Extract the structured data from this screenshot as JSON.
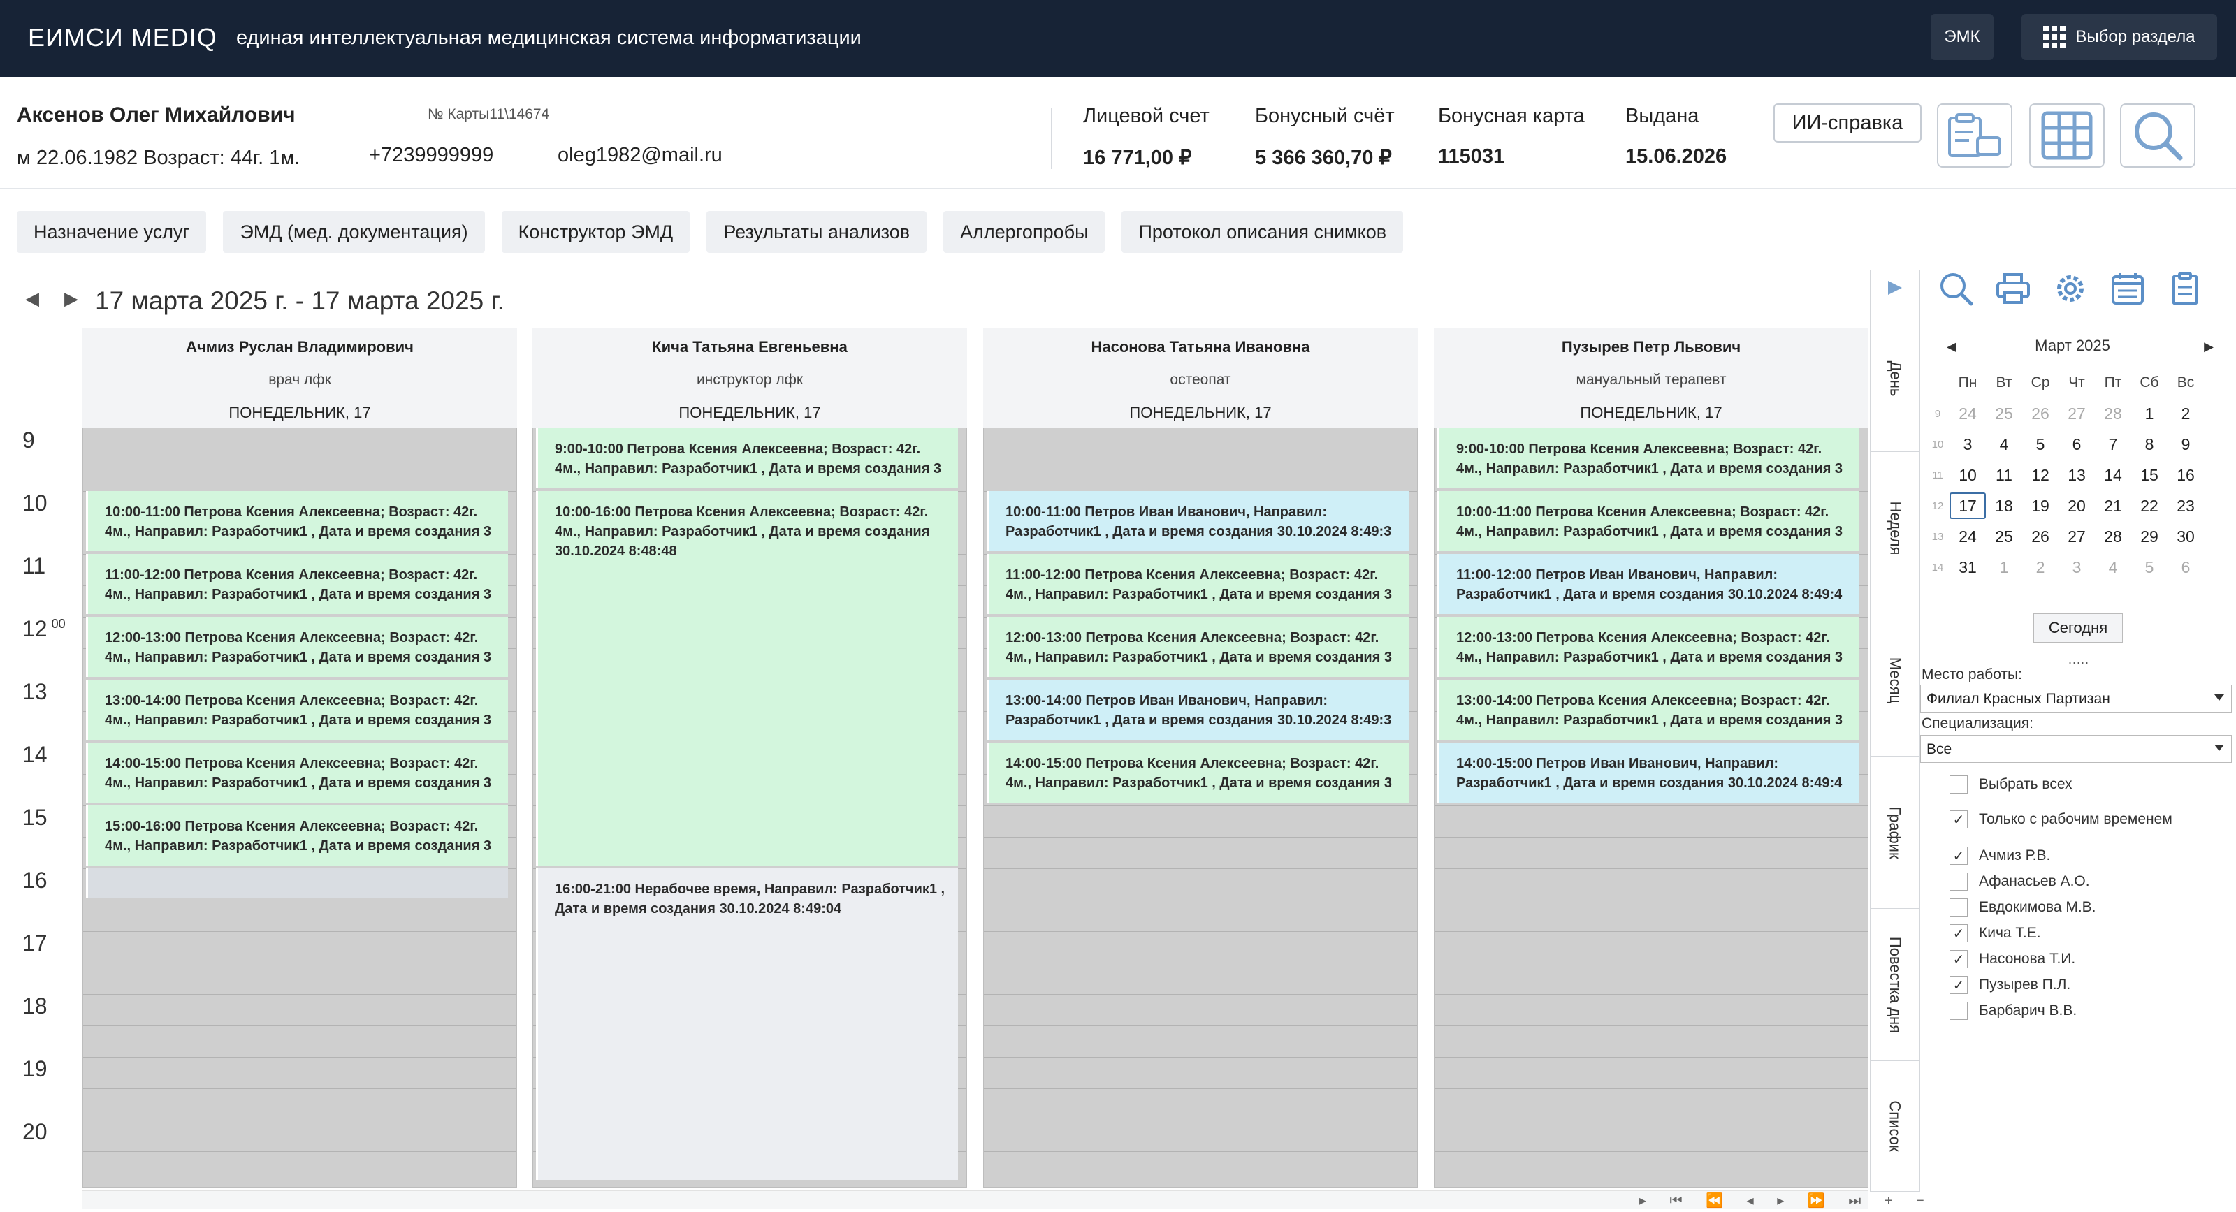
{
  "topbar": {
    "logo": "ЕИМСИ MEDIQ",
    "subtitle": "единая интеллектуальная медицинская система информатизации",
    "emk_button": "ЭМК",
    "section_button": "Выбор раздела"
  },
  "patient": {
    "name": "Аксенов Олег Михайлович",
    "card": "№ Карты11\\14674",
    "gender_dob_age": "м 22.06.1982 Возраст: 44г. 1м.",
    "phone": "+7239999999",
    "email": "oleg1982@mail.ru",
    "account_label": "Лицевой счет",
    "account_value": "16 771,00 ₽",
    "bonus_label": "Бонусный счёт",
    "bonus_value": "5 366 360,70 ₽",
    "card_label": "Бонусная карта",
    "card_value": "115031",
    "issued_label": "Выдана",
    "issued_value": "15.06.2026",
    "ai_button": "ИИ-справка"
  },
  "tabs": [
    "Назначение услуг",
    "ЭМД (мед. документация)",
    "Конструктор ЭМД",
    "Результаты анализов",
    "Аллергопробы",
    "Протокол описания снимков"
  ],
  "date_range": "17 марта 2025 г. - 17 марта 2025 г.",
  "hours": [
    "9",
    "10",
    "11",
    "12",
    "13",
    "14",
    "15",
    "16",
    "17",
    "18",
    "19",
    "20"
  ],
  "hour_minutes_label": "00",
  "doctors": [
    {
      "name": "Ачмиз Руслан Владимирович",
      "role": "врач лфк",
      "day": "ПОНЕДЕЛЬНИК, 17",
      "appointments": [
        {
          "text": "10:00-11:00 Петрова Ксения Алексеевна; Возраст: 42г. 4м., Направил: Разработчик1 , Дата и время создания 3",
          "color": "green"
        },
        {
          "text": "11:00-12:00 Петрова Ксения Алексеевна; Возраст: 42г. 4м., Направил: Разработчик1 , Дата и время создания 3",
          "color": "green"
        },
        {
          "text": "12:00-13:00 Петрова Ксения Алексеевна; Возраст: 42г. 4м., Направил: Разработчик1 , Дата и время создания 3",
          "color": "green"
        },
        {
          "text": "13:00-14:00 Петрова Ксения Алексеевна; Возраст: 42г. 4м., Направил: Разработчик1 , Дата и время создания 3",
          "color": "green"
        },
        {
          "text": "14:00-15:00 Петрова Ксения Алексеевна; Возраст: 42г. 4м., Направил: Разработчик1 , Дата и время создания 3",
          "color": "green"
        },
        {
          "text": "15:00-16:00 Петрова Ксения Алексеевна; Возраст: 42г. 4м., Направил: Разработчик1 , Дата и время создания 3",
          "color": "green"
        }
      ]
    },
    {
      "name": "Кича Татьяна Евгеньевна",
      "role": "инструктор лфк",
      "day": "ПОНЕДЕЛЬНИК, 17",
      "appointments": [
        {
          "text": "9:00-10:00 Петрова Ксения Алексеевна; Возраст: 42г. 4м., Направил: Разработчик1 , Дата и время создания 3",
          "color": "green"
        },
        {
          "text": "10:00-16:00 Петрова Ксения Алексеевна; Возраст: 42г. 4м., Направил: Разработчик1 , Дата и время создания 30.10.2024 8:48:48",
          "color": "green"
        },
        {
          "text": "16:00-21:00 Нерабочее время, Направил: Разработчик1 , Дата и время создания 30.10.2024 8:49:04",
          "color": "grey"
        }
      ]
    },
    {
      "name": "Насонова Татьяна Ивановна",
      "role": "остеопат",
      "day": "ПОНЕДЕЛЬНИК, 17",
      "appointments": [
        {
          "text": "10:00-11:00 Петров Иван Иванович, Направил: Разработчик1 , Дата и время создания 30.10.2024 8:49:3",
          "color": "blue"
        },
        {
          "text": "11:00-12:00 Петрова Ксения Алексеевна; Возраст: 42г. 4м., Направил: Разработчик1 , Дата и время создания 3",
          "color": "green"
        },
        {
          "text": "12:00-13:00 Петрова Ксения Алексеевна; Возраст: 42г. 4м., Направил: Разработчик1 , Дата и время создания 3",
          "color": "green"
        },
        {
          "text": "13:00-14:00 Петров Иван Иванович, Направил: Разработчик1 , Дата и время создания 30.10.2024 8:49:3",
          "color": "blue"
        },
        {
          "text": "14:00-15:00 Петрова Ксения Алексеевна; Возраст: 42г. 4м., Направил: Разработчик1 , Дата и время создания 3",
          "color": "green"
        }
      ]
    },
    {
      "name": "Пузырев Петр Львович",
      "role": "мануальный терапевт",
      "day": "ПОНЕДЕЛЬНИК, 17",
      "appointments": [
        {
          "text": "9:00-10:00 Петрова Ксения Алексеевна; Возраст: 42г. 4м., Направил: Разработчик1 , Дата и время создания 3",
          "color": "green"
        },
        {
          "text": "10:00-11:00 Петрова Ксения Алексеевна; Возраст: 42г. 4м., Направил: Разработчик1 , Дата и время создания 3",
          "color": "green"
        },
        {
          "text": "11:00-12:00 Петров Иван Иванович, Направил: Разработчик1 , Дата и время создания 30.10.2024 8:49:4",
          "color": "blue"
        },
        {
          "text": "12:00-13:00 Петрова Ксения Алексеевна; Возраст: 42г. 4м., Направил: Разработчик1 , Дата и время создания 3",
          "color": "green"
        },
        {
          "text": "13:00-14:00 Петрова Ксения Алексеевна; Возраст: 42г. 4м., Направил: Разработчик1 , Дата и время создания 3",
          "color": "green"
        },
        {
          "text": "14:00-15:00 Петров Иван Иванович, Направил: Разработчик1 , Дата и время создания 30.10.2024 8:49:4",
          "color": "blue"
        }
      ]
    }
  ],
  "view_tabs": [
    "День",
    "Неделя",
    "Месяц",
    "График",
    "Повестка дня",
    "Список"
  ],
  "calendar": {
    "month": "Март 2025",
    "dow": [
      "Пн",
      "Вт",
      "Ср",
      "Чт",
      "Пт",
      "Сб",
      "Вс"
    ],
    "weeks": [
      {
        "wk": "9",
        "days": [
          "24",
          "25",
          "26",
          "27",
          "28",
          "1",
          "2"
        ]
      },
      {
        "wk": "10",
        "days": [
          "3",
          "4",
          "5",
          "6",
          "7",
          "8",
          "9"
        ]
      },
      {
        "wk": "11",
        "days": [
          "10",
          "11",
          "12",
          "13",
          "14",
          "15",
          "16"
        ]
      },
      {
        "wk": "12",
        "days": [
          "17",
          "18",
          "19",
          "20",
          "21",
          "22",
          "23"
        ]
      },
      {
        "wk": "13",
        "days": [
          "24",
          "25",
          "26",
          "27",
          "28",
          "29",
          "30"
        ]
      },
      {
        "wk": "14",
        "days": [
          "31",
          "1",
          "2",
          "3",
          "4",
          "5",
          "6"
        ]
      }
    ],
    "today_button": "Сегодня",
    "dots": "....."
  },
  "filters": {
    "workplace_label": "Место работы:",
    "workplace_value": "Филиал Красных Партизан",
    "spec_label": "Специализация:",
    "spec_value": "Все",
    "select_all": "Выбрать всех",
    "working_only": "Только с рабочим временем",
    "doctors": [
      {
        "name": "Ачмиз Р.В.",
        "checked": true
      },
      {
        "name": "Афанасьев А.О.",
        "checked": false
      },
      {
        "name": "Евдокимова М.В.",
        "checked": false
      },
      {
        "name": "Кича Т.Е.",
        "checked": true
      },
      {
        "name": "Насонова Т.И.",
        "checked": true
      },
      {
        "name": "Пузырев П.Л.",
        "checked": true
      },
      {
        "name": "Барбарич В.В.",
        "checked": false
      }
    ]
  },
  "colors": {
    "topbar": "#172336",
    "appt_green": "#d3f6dd",
    "appt_blue": "#cfeff7",
    "nonwork": "#cfcfcf"
  }
}
